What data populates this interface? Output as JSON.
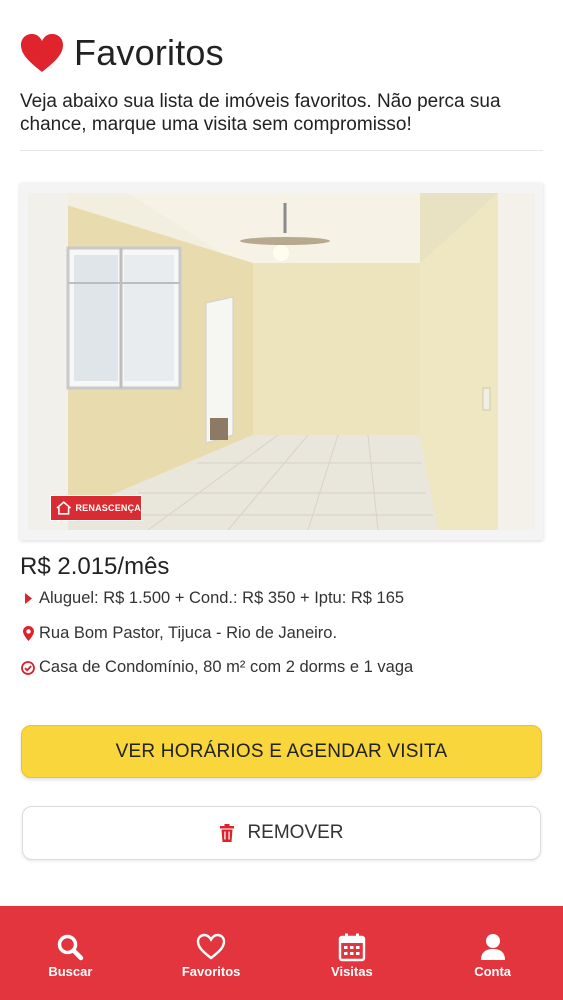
{
  "header": {
    "title": "Favoritos",
    "icon": "heart-icon",
    "subtitle": "Veja abaixo sua lista de imóveis favoritos. Não perca sua chance, marque uma visita sem compromisso!"
  },
  "listing": {
    "photo_watermark": "RENASCENÇA",
    "price": "R$ 2.015/mês",
    "cost_breakdown": "Aluguel: R$ 1.500 + Cond.: R$ 350 + Iptu: R$ 165",
    "address": "Rua Bom Pastor, Tijuca - Rio de Janeiro.",
    "description": "Casa de Condomínio, 80 m² com 2 dorms e 1 vaga"
  },
  "actions": {
    "schedule_label": "VER HORÁRIOS E AGENDAR VISITA",
    "remove_label": "REMOVER"
  },
  "bottom_nav": {
    "items": [
      {
        "label": "Buscar",
        "icon": "search-icon"
      },
      {
        "label": "Favoritos",
        "icon": "heart-outline-icon"
      },
      {
        "label": "Visitas",
        "icon": "calendar-icon"
      },
      {
        "label": "Conta",
        "icon": "user-icon"
      }
    ]
  },
  "colors": {
    "brand_red": "#e3353d",
    "button_yellow": "#f8d63c"
  }
}
